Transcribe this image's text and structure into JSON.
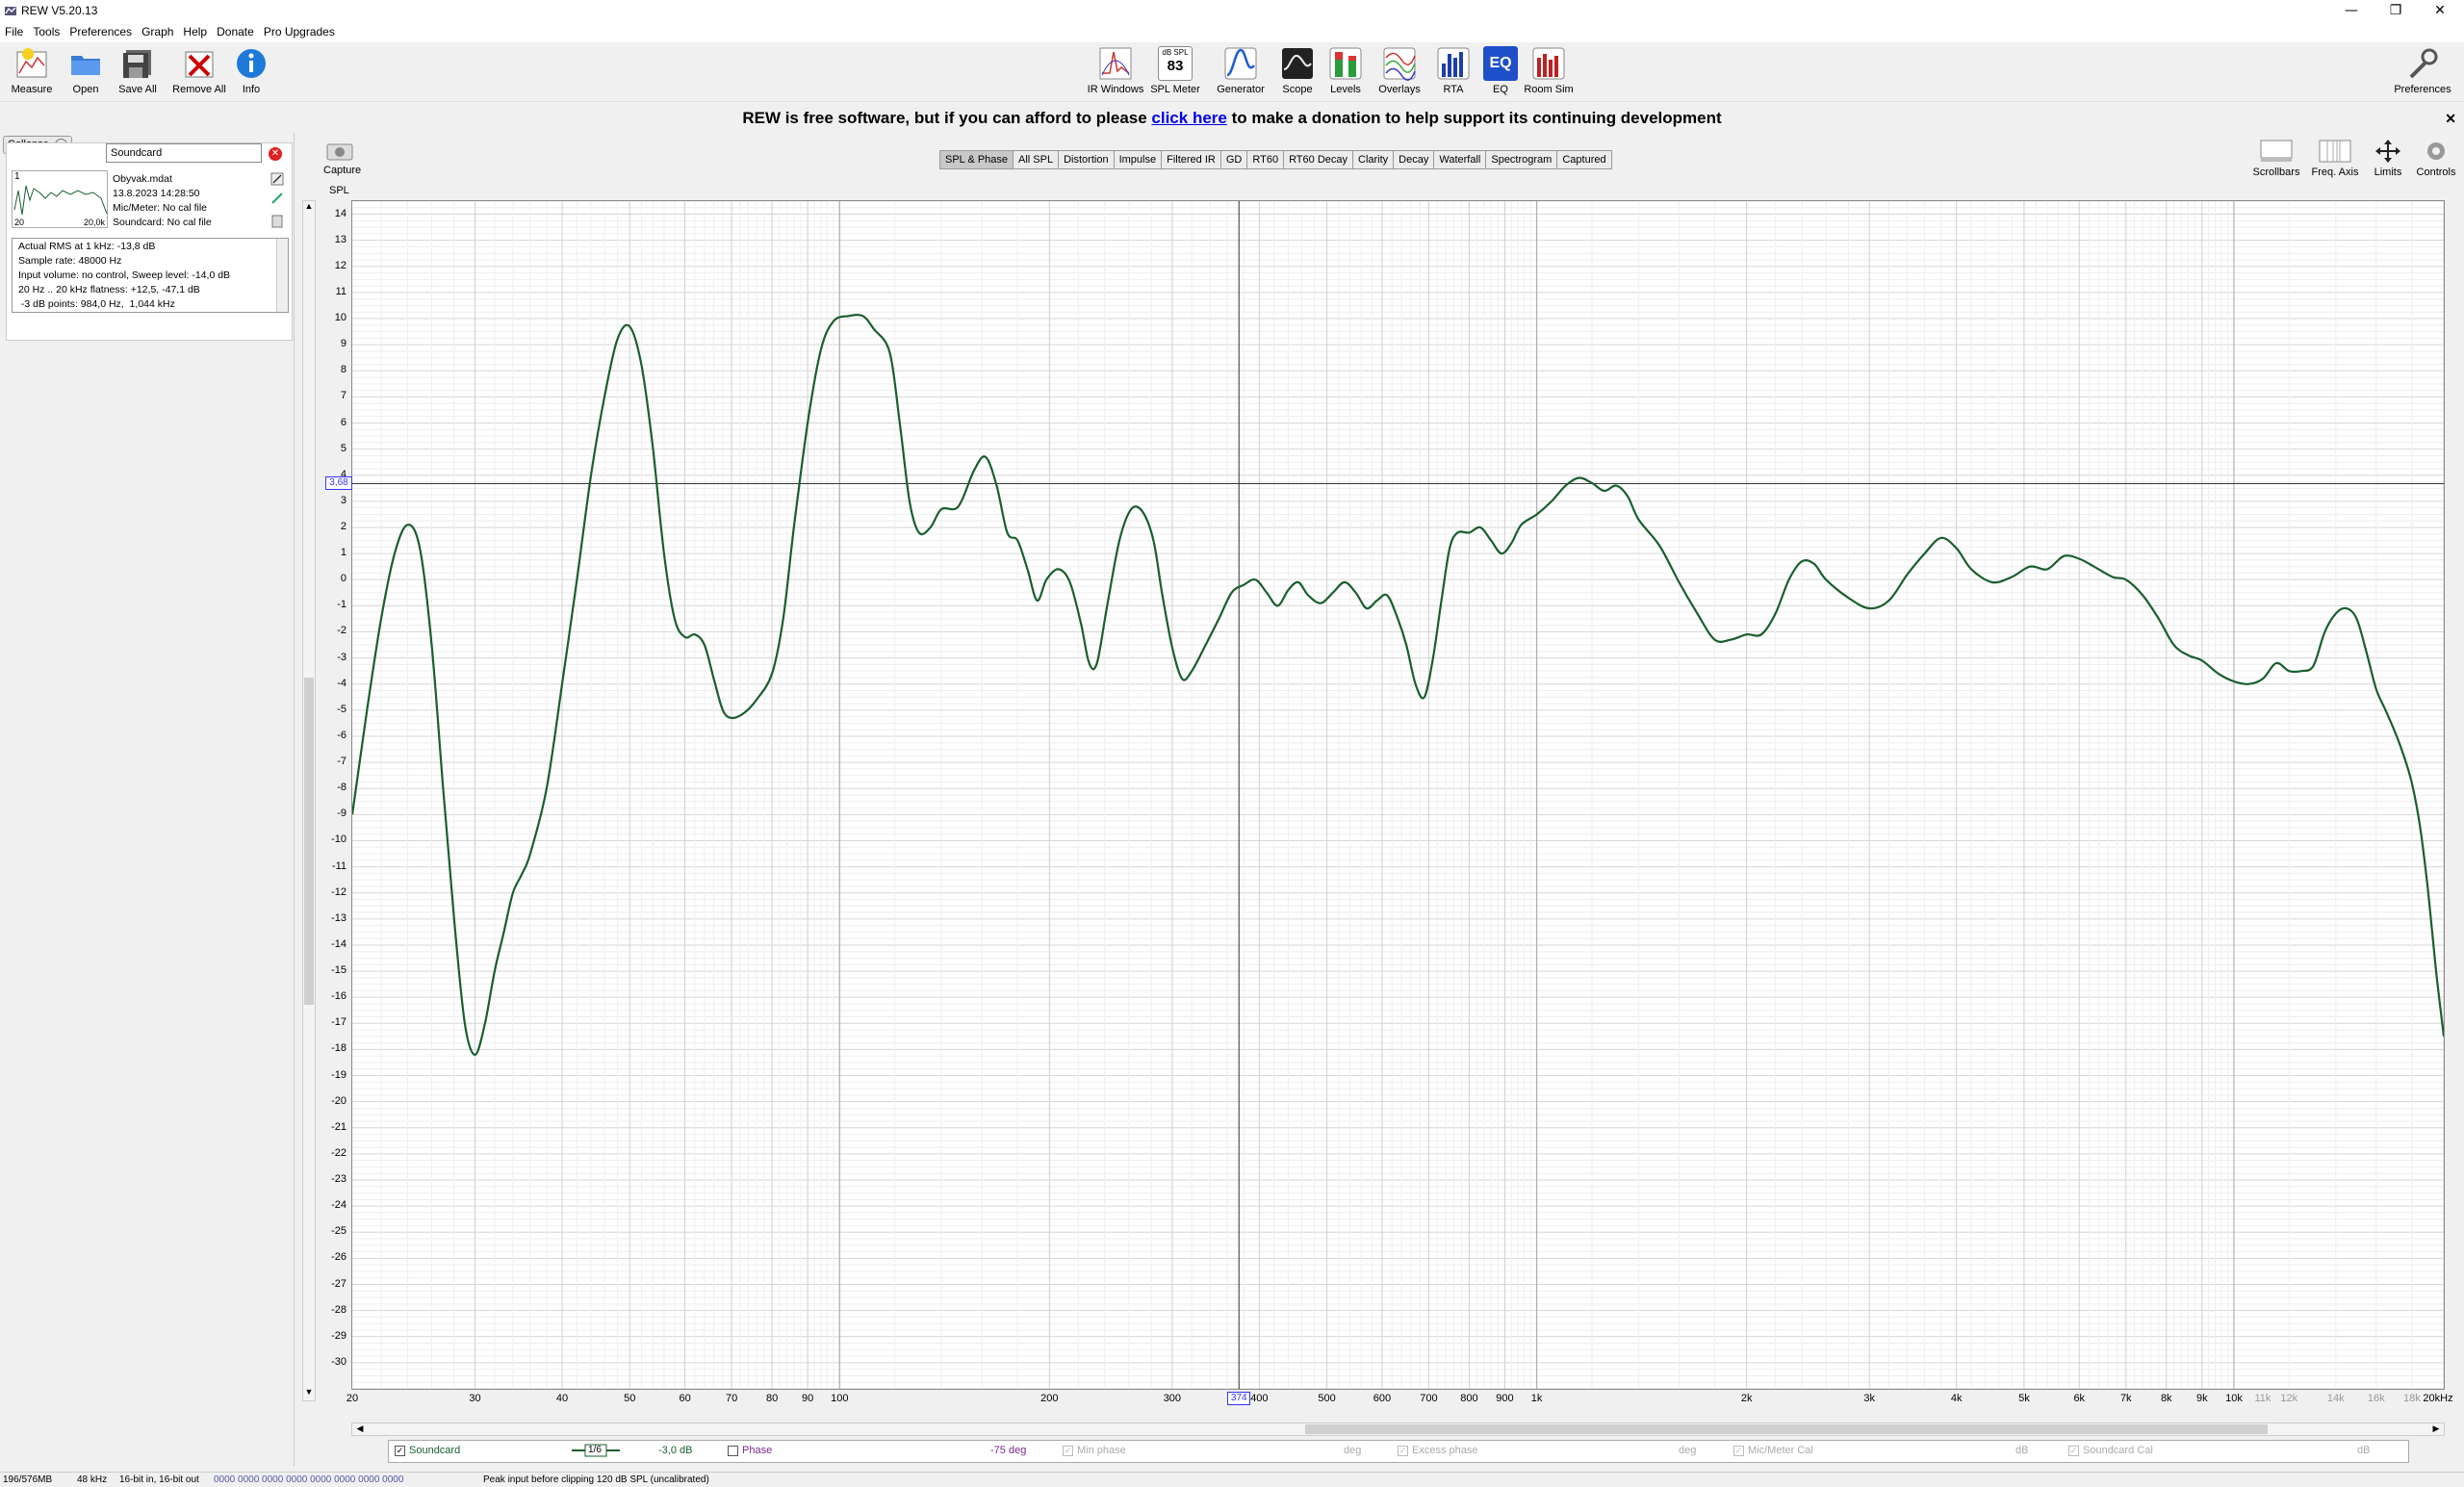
{
  "window": {
    "title": "REW V5.20.13"
  },
  "menu": [
    "File",
    "Tools",
    "Preferences",
    "Graph",
    "Help",
    "Donate",
    "Pro Upgrades"
  ],
  "toolbar": {
    "left": [
      {
        "name": "measure",
        "label": "Measure"
      },
      {
        "name": "open",
        "label": "Open"
      },
      {
        "name": "save-all",
        "label": "Save All"
      },
      {
        "name": "remove-all",
        "label": "Remove All"
      },
      {
        "name": "info",
        "label": "Info"
      }
    ],
    "center": [
      {
        "name": "ir-windows",
        "label": "IR Windows"
      },
      {
        "name": "spl-meter",
        "label": "SPL Meter",
        "value": "83",
        "unit": "dB SPL"
      },
      {
        "name": "generator",
        "label": "Generator"
      },
      {
        "name": "scope",
        "label": "Scope"
      },
      {
        "name": "levels",
        "label": "Levels"
      },
      {
        "name": "overlays",
        "label": "Overlays"
      },
      {
        "name": "rta",
        "label": "RTA"
      },
      {
        "name": "eq",
        "label": "EQ",
        "text": "EQ"
      },
      {
        "name": "room-sim",
        "label": "Room Sim"
      }
    ],
    "preferences_label": "Preferences"
  },
  "banner": {
    "before": "REW is free software, but if you can afford to please ",
    "link": "click here",
    "after": " to make a donation to help support its continuing development",
    "close": "✕"
  },
  "left_panel": {
    "collapse_label": "Collapse",
    "collapse_icon": "«",
    "measurement_name": "Soundcard",
    "thumb_index": "1",
    "thumb_left": "20",
    "thumb_right": "20,0k",
    "file_name": "Obyvak.mdat",
    "date": "13.8.2023 14:28:50",
    "mic_meter": "Mic/Meter: No cal file",
    "soundcard": "Soundcard: No cal file",
    "info_lines": [
      "Actual RMS at 1 kHz: -13,8 dB",
      "Sample rate: 48000 Hz",
      "Input volume: no control, Sweep level: -14,0 dB",
      "20 Hz .. 20 kHz flatness: +12,5, -47,1 dB",
      " -3 dB points: 984,0 Hz,  1,044 kHz"
    ]
  },
  "graph": {
    "capture_label": "Capture",
    "spl_label": "SPL",
    "tabs": [
      "SPL & Phase",
      "All SPL",
      "Distortion",
      "Impulse",
      "Filtered IR",
      "GD",
      "RT60",
      "RT60 Decay",
      "Clarity",
      "Decay",
      "Waterfall",
      "Spectrogram",
      "Captured"
    ],
    "selected_tab": "SPL & Phase",
    "right_controls": [
      "Scrollbars",
      "Freq. Axis",
      "Limits",
      "Controls"
    ],
    "cursor_y_label": "3,68",
    "cursor_x_label": "374"
  },
  "chart_data": {
    "type": "line",
    "title": "",
    "xlabel": "",
    "ylabel": "SPL",
    "x_scale": "log",
    "xlim": [
      20,
      20000
    ],
    "ylim": [
      -31,
      14.5
    ],
    "y_ticks": [
      14,
      13,
      12,
      11,
      10,
      9,
      8,
      7,
      6,
      5,
      4,
      3,
      2,
      1,
      0,
      -1,
      -2,
      -3,
      -4,
      -5,
      -6,
      -7,
      -8,
      -9,
      -10,
      -11,
      -12,
      -13,
      -14,
      -15,
      -16,
      -17,
      -18,
      -19,
      -20,
      -21,
      -22,
      -23,
      -24,
      -25,
      -26,
      -27,
      -28,
      -29,
      -30
    ],
    "x_ticks": [
      {
        "v": 20,
        "t": "20"
      },
      {
        "v": 30,
        "t": "30"
      },
      {
        "v": 40,
        "t": "40"
      },
      {
        "v": 50,
        "t": "50"
      },
      {
        "v": 60,
        "t": "60"
      },
      {
        "v": 70,
        "t": "70"
      },
      {
        "v": 80,
        "t": "80"
      },
      {
        "v": 90,
        "t": "90"
      },
      {
        "v": 100,
        "t": "100"
      },
      {
        "v": 200,
        "t": "200"
      },
      {
        "v": 300,
        "t": "300"
      },
      {
        "v": 400,
        "t": "400"
      },
      {
        "v": 500,
        "t": "500"
      },
      {
        "v": 600,
        "t": "600"
      },
      {
        "v": 700,
        "t": "700"
      },
      {
        "v": 800,
        "t": "800"
      },
      {
        "v": 900,
        "t": "900"
      },
      {
        "v": 1000,
        "t": "1k"
      },
      {
        "v": 2000,
        "t": "2k"
      },
      {
        "v": 3000,
        "t": "3k"
      },
      {
        "v": 4000,
        "t": "4k"
      },
      {
        "v": 5000,
        "t": "5k"
      },
      {
        "v": 6000,
        "t": "6k"
      },
      {
        "v": 7000,
        "t": "7k"
      },
      {
        "v": 8000,
        "t": "8k"
      },
      {
        "v": 9000,
        "t": "9k"
      },
      {
        "v": 10000,
        "t": "10k"
      },
      {
        "v": 11000,
        "t": "11k"
      },
      {
        "v": 12000,
        "t": "12k"
      },
      {
        "v": 14000,
        "t": "14k"
      },
      {
        "v": 16000,
        "t": "16k"
      },
      {
        "v": 18000,
        "t": "18k"
      },
      {
        "v": 20000,
        "t": "20kHz"
      }
    ],
    "cursor": {
      "x": 374,
      "y": 3.68
    },
    "grid": true,
    "series": [
      {
        "name": "Soundcard",
        "color": "#1a5e2e",
        "points": [
          [
            20,
            -9
          ],
          [
            21,
            -5
          ],
          [
            22,
            -1.5
          ],
          [
            23,
            1
          ],
          [
            24,
            2.1
          ],
          [
            25,
            1.2
          ],
          [
            26,
            -2.5
          ],
          [
            27,
            -8
          ],
          [
            28,
            -13
          ],
          [
            29,
            -17
          ],
          [
            30,
            -18.2
          ],
          [
            31,
            -17
          ],
          [
            32,
            -15
          ],
          [
            33,
            -13.5
          ],
          [
            34,
            -12
          ],
          [
            35,
            -11.3
          ],
          [
            36,
            -10.5
          ],
          [
            38,
            -8
          ],
          [
            40,
            -4
          ],
          [
            42,
            0
          ],
          [
            44,
            4
          ],
          [
            46,
            7
          ],
          [
            48,
            9.2
          ],
          [
            50,
            9.7
          ],
          [
            52,
            8.2
          ],
          [
            54,
            5
          ],
          [
            56,
            1
          ],
          [
            58,
            -1.5
          ],
          [
            60,
            -2.2
          ],
          [
            62,
            -2.1
          ],
          [
            64,
            -2.5
          ],
          [
            66,
            -3.8
          ],
          [
            68,
            -5
          ],
          [
            70,
            -5.3
          ],
          [
            73,
            -5.1
          ],
          [
            76,
            -4.6
          ],
          [
            80,
            -3.6
          ],
          [
            83,
            -1.5
          ],
          [
            86,
            2
          ],
          [
            90,
            6
          ],
          [
            94,
            8.8
          ],
          [
            98,
            9.9
          ],
          [
            103,
            10.1
          ],
          [
            108,
            10.1
          ],
          [
            112,
            9.6
          ],
          [
            118,
            8.7
          ],
          [
            122,
            6
          ],
          [
            126,
            3
          ],
          [
            130,
            1.8
          ],
          [
            135,
            2
          ],
          [
            140,
            2.7
          ],
          [
            148,
            2.8
          ],
          [
            156,
            4.2
          ],
          [
            162,
            4.7
          ],
          [
            168,
            3.6
          ],
          [
            174,
            1.8
          ],
          [
            180,
            1.5
          ],
          [
            186,
            0.4
          ],
          [
            192,
            -0.8
          ],
          [
            198,
            0
          ],
          [
            206,
            0.4
          ],
          [
            214,
            -0.1
          ],
          [
            222,
            -1.7
          ],
          [
            228,
            -3.2
          ],
          [
            234,
            -3.2
          ],
          [
            242,
            -1
          ],
          [
            252,
            1.5
          ],
          [
            262,
            2.7
          ],
          [
            272,
            2.6
          ],
          [
            282,
            1.5
          ],
          [
            290,
            -0.5
          ],
          [
            300,
            -2.6
          ],
          [
            310,
            -3.8
          ],
          [
            320,
            -3.5
          ],
          [
            335,
            -2.5
          ],
          [
            350,
            -1.5
          ],
          [
            365,
            -0.5
          ],
          [
            380,
            -0.2
          ],
          [
            395,
            0
          ],
          [
            410,
            -0.5
          ],
          [
            425,
            -1
          ],
          [
            440,
            -0.4
          ],
          [
            455,
            -0.1
          ],
          [
            470,
            -0.6
          ],
          [
            490,
            -0.9
          ],
          [
            510,
            -0.5
          ],
          [
            530,
            -0.1
          ],
          [
            550,
            -0.5
          ],
          [
            570,
            -1.1
          ],
          [
            590,
            -0.8
          ],
          [
            610,
            -0.6
          ],
          [
            630,
            -1.4
          ],
          [
            650,
            -2.5
          ],
          [
            670,
            -4
          ],
          [
            690,
            -4.5
          ],
          [
            710,
            -3
          ],
          [
            730,
            -0.8
          ],
          [
            750,
            1.2
          ],
          [
            770,
            1.8
          ],
          [
            800,
            1.8
          ],
          [
            830,
            2
          ],
          [
            860,
            1.5
          ],
          [
            890,
            1.0
          ],
          [
            920,
            1.4
          ],
          [
            950,
            2.1
          ],
          [
            1000,
            2.5
          ],
          [
            1050,
            3
          ],
          [
            1100,
            3.6
          ],
          [
            1150,
            3.9
          ],
          [
            1200,
            3.7
          ],
          [
            1250,
            3.4
          ],
          [
            1300,
            3.6
          ],
          [
            1350,
            3.2
          ],
          [
            1400,
            2.3
          ],
          [
            1500,
            1.3
          ],
          [
            1600,
            -0.1
          ],
          [
            1700,
            -1.3
          ],
          [
            1800,
            -2.3
          ],
          [
            1900,
            -2.3
          ],
          [
            2000,
            -2.1
          ],
          [
            2100,
            -2.1
          ],
          [
            2200,
            -1.3
          ],
          [
            2300,
            0
          ],
          [
            2400,
            0.7
          ],
          [
            2500,
            0.6
          ],
          [
            2600,
            0
          ],
          [
            2800,
            -0.7
          ],
          [
            3000,
            -1.1
          ],
          [
            3200,
            -0.8
          ],
          [
            3400,
            0.2
          ],
          [
            3600,
            1
          ],
          [
            3800,
            1.6
          ],
          [
            4000,
            1.2
          ],
          [
            4200,
            0.4
          ],
          [
            4500,
            -0.1
          ],
          [
            4800,
            0.1
          ],
          [
            5100,
            0.5
          ],
          [
            5400,
            0.4
          ],
          [
            5700,
            0.9
          ],
          [
            6000,
            0.8
          ],
          [
            6300,
            0.5
          ],
          [
            6700,
            0.1
          ],
          [
            7000,
            0
          ],
          [
            7400,
            -0.6
          ],
          [
            7800,
            -1.5
          ],
          [
            8200,
            -2.5
          ],
          [
            8600,
            -2.9
          ],
          [
            9000,
            -3.1
          ],
          [
            9500,
            -3.6
          ],
          [
            10000,
            -3.9
          ],
          [
            10500,
            -4
          ],
          [
            11000,
            -3.8
          ],
          [
            11500,
            -3.2
          ],
          [
            12000,
            -3.5
          ],
          [
            12500,
            -3.5
          ],
          [
            13000,
            -3.3
          ],
          [
            13500,
            -2
          ],
          [
            14000,
            -1.3
          ],
          [
            14500,
            -1.1
          ],
          [
            15000,
            -1.5
          ],
          [
            15500,
            -2.8
          ],
          [
            16000,
            -4.2
          ],
          [
            16500,
            -5
          ],
          [
            17000,
            -5.8
          ],
          [
            17500,
            -6.7
          ],
          [
            18000,
            -7.8
          ],
          [
            18500,
            -9.5
          ],
          [
            19000,
            -12
          ],
          [
            19500,
            -15
          ],
          [
            20000,
            -17.5
          ]
        ]
      }
    ]
  },
  "legend": {
    "soundcard": "Soundcard",
    "smoothing": "1/6",
    "offset": "-3,0 dB",
    "phase": "Phase",
    "phase_offset": "-75 deg",
    "min_phase": "Min phase",
    "min_phase_unit": "deg",
    "excess_phase": "Excess phase",
    "excess_phase_unit": "deg",
    "mic_cal": "Mic/Meter Cal",
    "mic_cal_unit": "dB",
    "sc_cal": "Soundcard Cal",
    "sc_cal_unit": "dB"
  },
  "status": {
    "memory": "196/576MB",
    "rate": "48 kHz",
    "bits": "16-bit in, 16-bit out",
    "levels": "0000 0000 0000 0000 0000 0000 0000 0000",
    "message": "Peak input before clipping 120 dB SPL (uncalibrated)"
  },
  "colors": {
    "curve": "#1a5e2e",
    "link": "#0000ee",
    "plot_bg": "#ffffff",
    "grid": "#e6e6e6"
  }
}
